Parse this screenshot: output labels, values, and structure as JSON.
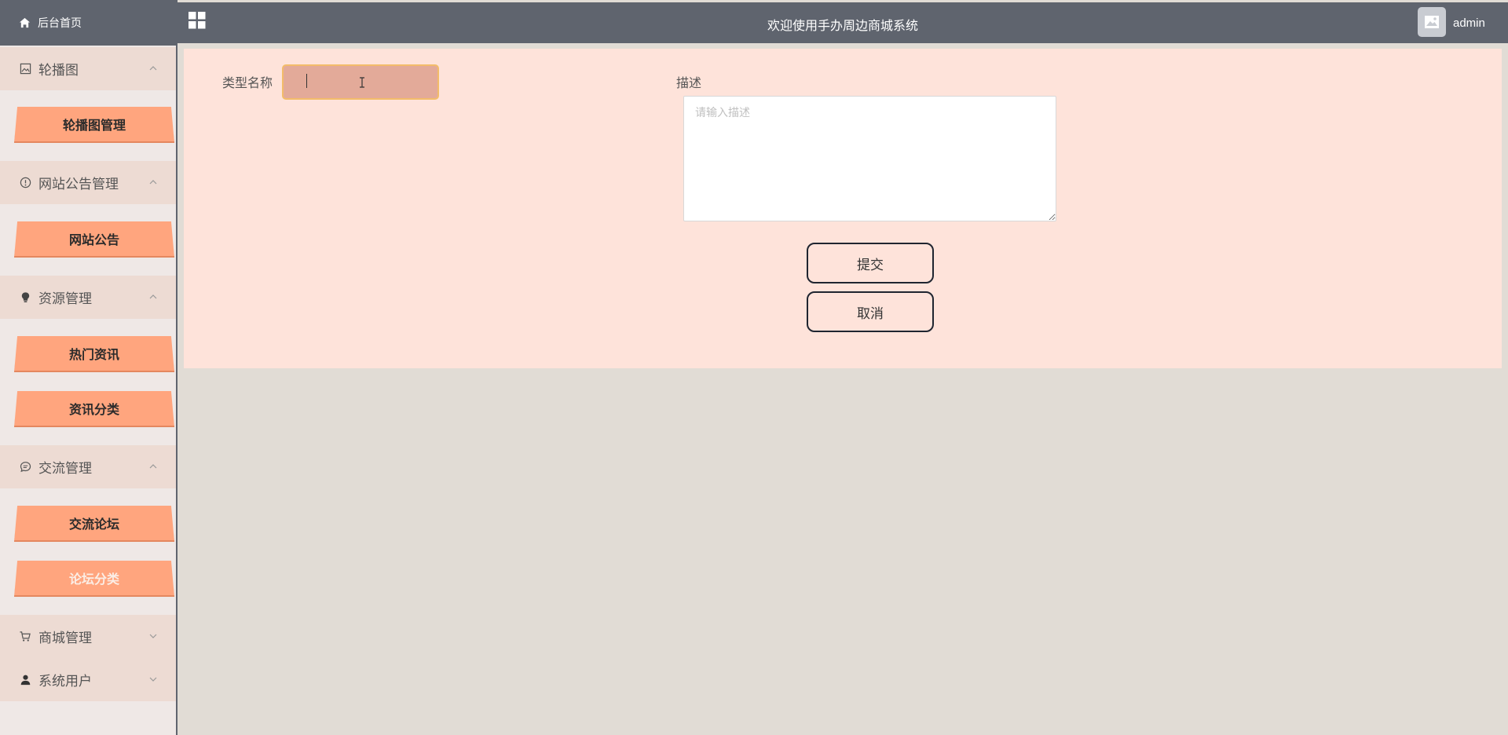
{
  "sidebar": {
    "home_label": "后台首页",
    "groups": [
      {
        "label": "轮播图",
        "icon": "image-icon",
        "items": [
          "轮播图管理"
        ]
      },
      {
        "label": "网站公告管理",
        "icon": "info-icon",
        "items": [
          "网站公告"
        ]
      },
      {
        "label": "资源管理",
        "icon": "bulb-icon",
        "items": [
          "热门资讯",
          "资讯分类"
        ]
      },
      {
        "label": "交流管理",
        "icon": "chat-icon",
        "items": [
          "交流论坛",
          "论坛分类"
        ]
      },
      {
        "label": "商城管理",
        "icon": "cart-icon",
        "items": []
      },
      {
        "label": "系统用户",
        "icon": "user-icon",
        "items": []
      }
    ],
    "active_item": "论坛分类"
  },
  "header": {
    "title": "欢迎使用手办周边商城系统",
    "username": "admin"
  },
  "form": {
    "name_label": "类型名称",
    "name_value": "",
    "desc_label": "描述",
    "desc_placeholder": "请输入描述",
    "submit_label": "提交",
    "cancel_label": "取消"
  },
  "colors": {
    "topbar": "#5f646e",
    "menu_button": "#ffa57e",
    "panel": "#fee3da",
    "input_focus": "#e3aa99"
  }
}
